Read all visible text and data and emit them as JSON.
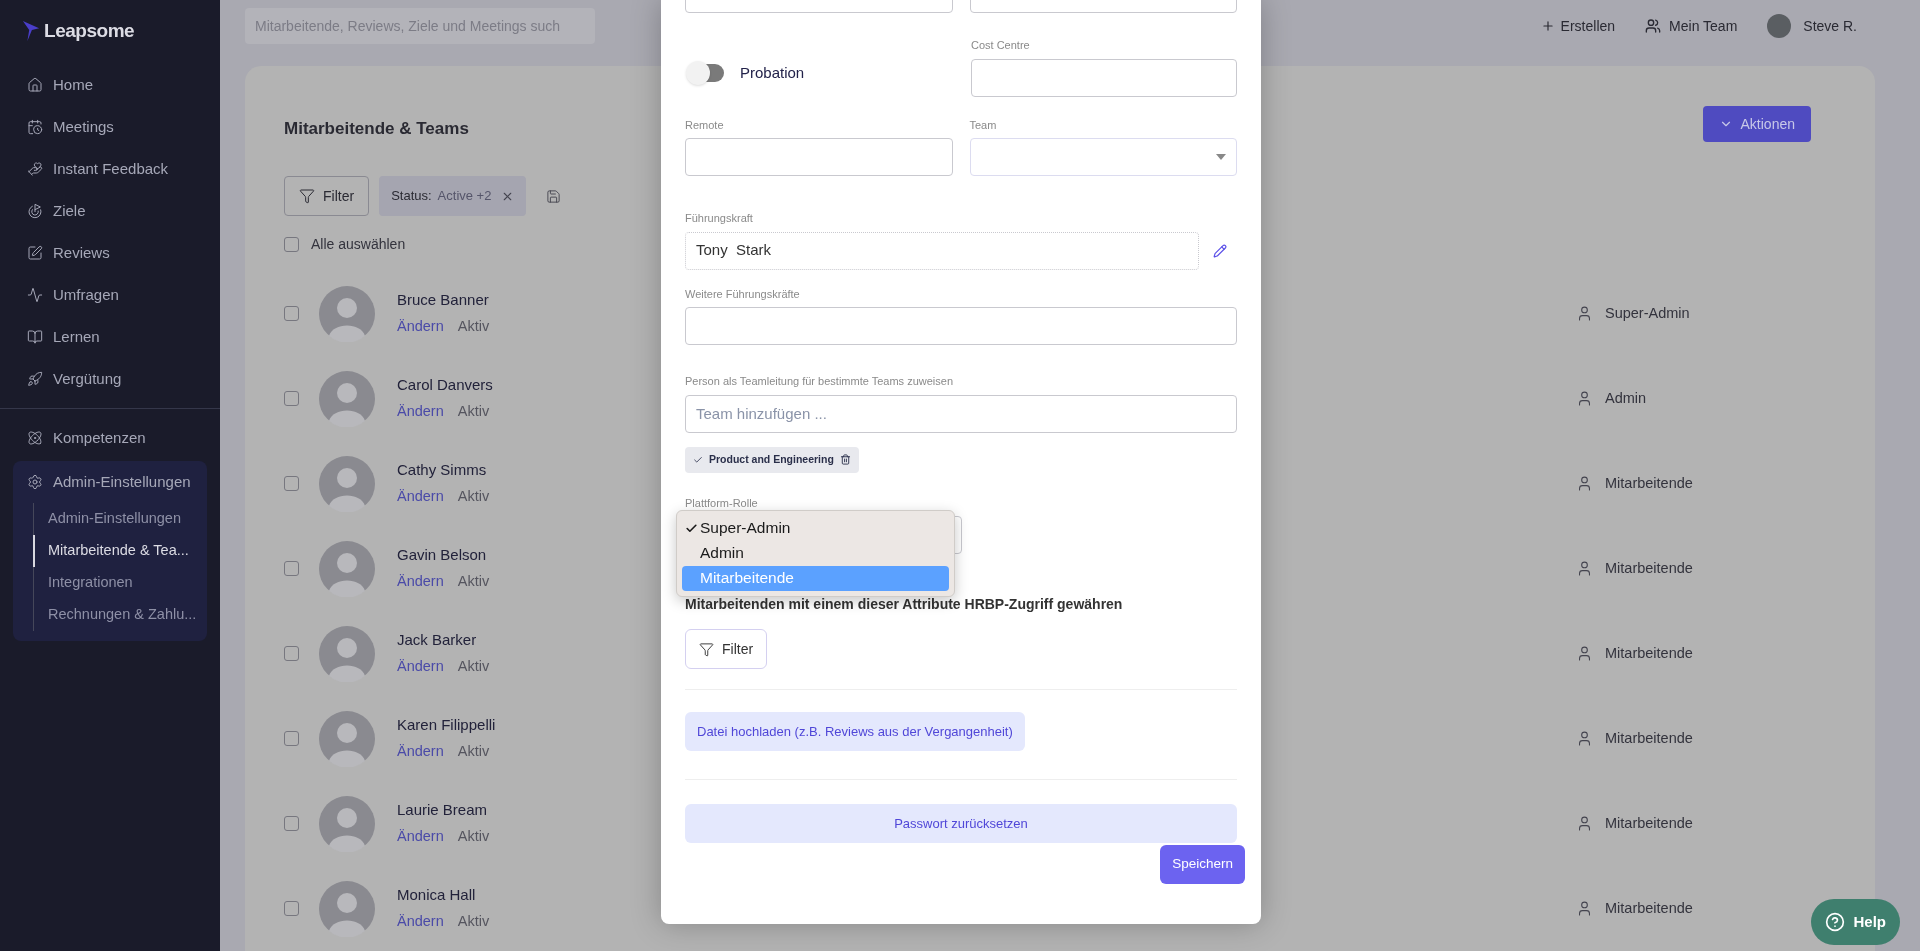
{
  "sidebar": {
    "logo": "Leapsome",
    "items": [
      {
        "label": "Home"
      },
      {
        "label": "Meetings"
      },
      {
        "label": "Instant Feedback"
      },
      {
        "label": "Ziele"
      },
      {
        "label": "Reviews"
      },
      {
        "label": "Umfragen"
      },
      {
        "label": "Lernen"
      },
      {
        "label": "Vergütung"
      }
    ],
    "secondary": [
      {
        "label": "Kompetenzen"
      }
    ],
    "admin": {
      "label": "Admin-Einstellungen",
      "expanded": true,
      "children": [
        {
          "label": "Admin-Einstellungen",
          "selected": false
        },
        {
          "label": "Mitarbeitende & Tea...",
          "selected": true
        },
        {
          "label": "Integrationen",
          "selected": false
        },
        {
          "label": "Rechnungen & Zahlu...",
          "selected": false
        }
      ]
    }
  },
  "topbar": {
    "search": {
      "placeholder": "Mitarbeitende, Reviews, Ziele und Meetings such"
    },
    "create": "Erstellen",
    "team": "Mein Team",
    "user": "Steve R."
  },
  "main": {
    "title": "Mitarbeitende & Teams",
    "actions": "Aktionen",
    "filter": "Filter",
    "status_chip": {
      "key": "Status:",
      "value": "Active +2"
    },
    "select_all": {
      "label": "Alle auswählen",
      "checked": false
    },
    "people": [
      {
        "name": "Bruce Banner",
        "edit": "Ändern",
        "status": "Aktiv",
        "role": "Super-Admin",
        "checked": false
      },
      {
        "name": "Carol Danvers",
        "edit": "Ändern",
        "status": "Aktiv",
        "role": "Admin",
        "checked": false
      },
      {
        "name": "Cathy Simms",
        "edit": "Ändern",
        "status": "Aktiv",
        "role": "Mitarbeitende",
        "checked": false
      },
      {
        "name": "Gavin Belson",
        "edit": "Ändern",
        "status": "Aktiv",
        "role": "Mitarbeitende",
        "checked": false
      },
      {
        "name": "Jack Barker",
        "edit": "Ändern",
        "status": "Aktiv",
        "role": "Mitarbeitende",
        "checked": false
      },
      {
        "name": "Karen Filippelli",
        "edit": "Ändern",
        "status": "Aktiv",
        "role": "Mitarbeitende",
        "checked": false
      },
      {
        "name": "Laurie Bream",
        "edit": "Ändern",
        "status": "Aktiv",
        "role": "Mitarbeitende",
        "checked": false
      },
      {
        "name": "Monica Hall",
        "edit": "Ändern",
        "status": "Aktiv",
        "role": "Mitarbeitende",
        "checked": false
      }
    ]
  },
  "modal": {
    "probation": {
      "label": "Probation",
      "on": false
    },
    "cost_centre": {
      "label": "Cost Centre"
    },
    "remote": {
      "label": "Remote"
    },
    "team": {
      "label": "Team"
    },
    "manager": {
      "label": "Führungskraft",
      "value": "Tony  Stark"
    },
    "more_managers": {
      "label": "Weitere Führungskräfte"
    },
    "team_lead": {
      "label": "Person als Teamleitung für bestimmte Teams zuweisen",
      "placeholder": "Team hinzufügen ...",
      "chips": [
        {
          "label": "Product and Engineering"
        }
      ]
    },
    "role": {
      "label": "Plattform-Rolle",
      "options": [
        {
          "label": "Super-Admin",
          "checked": true,
          "selected": false
        },
        {
          "label": "Admin",
          "checked": false,
          "selected": false
        },
        {
          "label": "Mitarbeitende",
          "checked": false,
          "selected": true
        }
      ]
    },
    "hrbp": {
      "heading": "Mitarbeitenden mit einem dieser Attribute HRBP-Zugriff gewähren",
      "filter": "Filter"
    },
    "upload": "Datei hochladen (z.B. Reviews aus der Vergangenheit)",
    "reset": "Passwort zurücksetzen",
    "save": "Speichern"
  },
  "help": "Help"
}
